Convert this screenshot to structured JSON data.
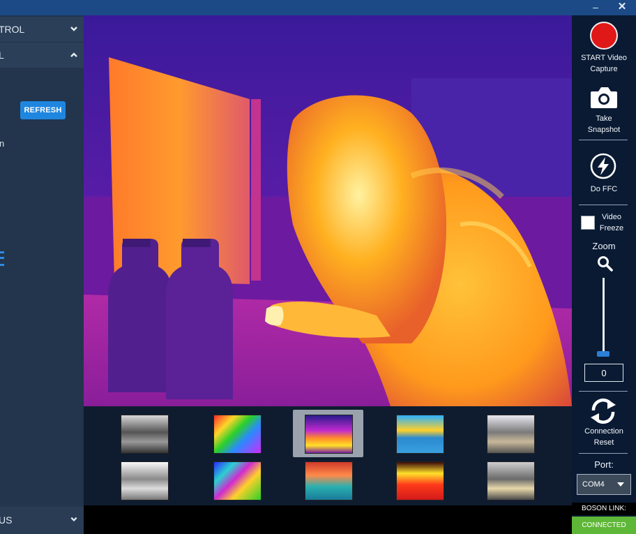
{
  "sidebar": {
    "sections": [
      {
        "label": "TROL",
        "state": "collapsed"
      },
      {
        "label": "L",
        "state": "expanded"
      },
      {
        "label": "US",
        "state": "collapsed"
      }
    ],
    "refresh_label": "REFRESH",
    "fragment_text": "n"
  },
  "palettes": {
    "selected_index": 2,
    "count": 10
  },
  "controls": {
    "record_label_1": "START Video",
    "record_label_2": "Capture",
    "snapshot_label_1": "Take",
    "snapshot_label_2": "Snapshot",
    "ffc_label": "Do FFC",
    "freeze_label_1": "Video",
    "freeze_label_2": "Freeze",
    "zoom_label": "Zoom",
    "zoom_value": "0",
    "reset_label_1": "Connection",
    "reset_label_2": "Reset",
    "port_label": "Port:",
    "port_value": "COM4",
    "link_label": "BOSON LINK:",
    "link_status": "CONNECTED"
  },
  "colors": {
    "titlebar": "#1c4a86",
    "accent": "#1f86e0",
    "record": "#e01818",
    "connected": "#5fb738"
  },
  "icons": [
    "minimize-icon",
    "close-icon",
    "chevron-down-icon",
    "chevron-up-icon",
    "camera-icon",
    "lightning-icon",
    "search-icon",
    "refresh-icon",
    "dropdown-arrow-icon"
  ]
}
